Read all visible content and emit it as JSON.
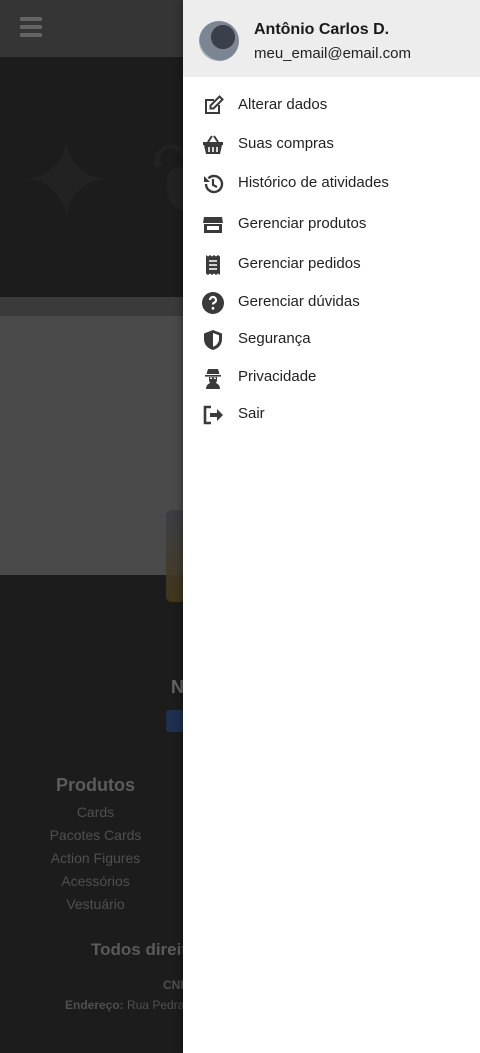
{
  "drawer": {
    "user": {
      "name": "Antônio Carlos D.",
      "email": "meu_email@email.com"
    },
    "menu": [
      {
        "label": "Alterar dados",
        "icon": "edit-icon"
      },
      {
        "label": "Suas compras",
        "icon": "basket-icon"
      },
      {
        "label": "Histórico de atividades",
        "icon": "history-icon"
      },
      {
        "label": "Gerenciar produtos",
        "icon": "store-icon"
      },
      {
        "label": "Gerenciar pedidos",
        "icon": "receipt-icon"
      },
      {
        "label": "Gerenciar dúvidas",
        "icon": "question-circle-icon"
      },
      {
        "label": "Segurança",
        "icon": "shield-icon"
      },
      {
        "label": "Privacidade",
        "icon": "user-secret-icon"
      },
      {
        "label": "Sair",
        "icon": "sign-out-icon"
      }
    ]
  },
  "background": {
    "footer": {
      "products_title": "Produtos",
      "products_links": [
        "Cards",
        "Pacotes Cards",
        "Action Figures",
        "Acessórios",
        "Vestuário"
      ],
      "rights_text": "Todos direit",
      "cnpj_text": "CNI",
      "address_label": "Endereço:",
      "address_value": "Rua Pedra",
      "partial_heading": "N"
    }
  },
  "colors": {
    "drawer_header_bg": "#ededed",
    "topbar_bg": "#525252",
    "footer_bg": "#2b2b2b"
  }
}
